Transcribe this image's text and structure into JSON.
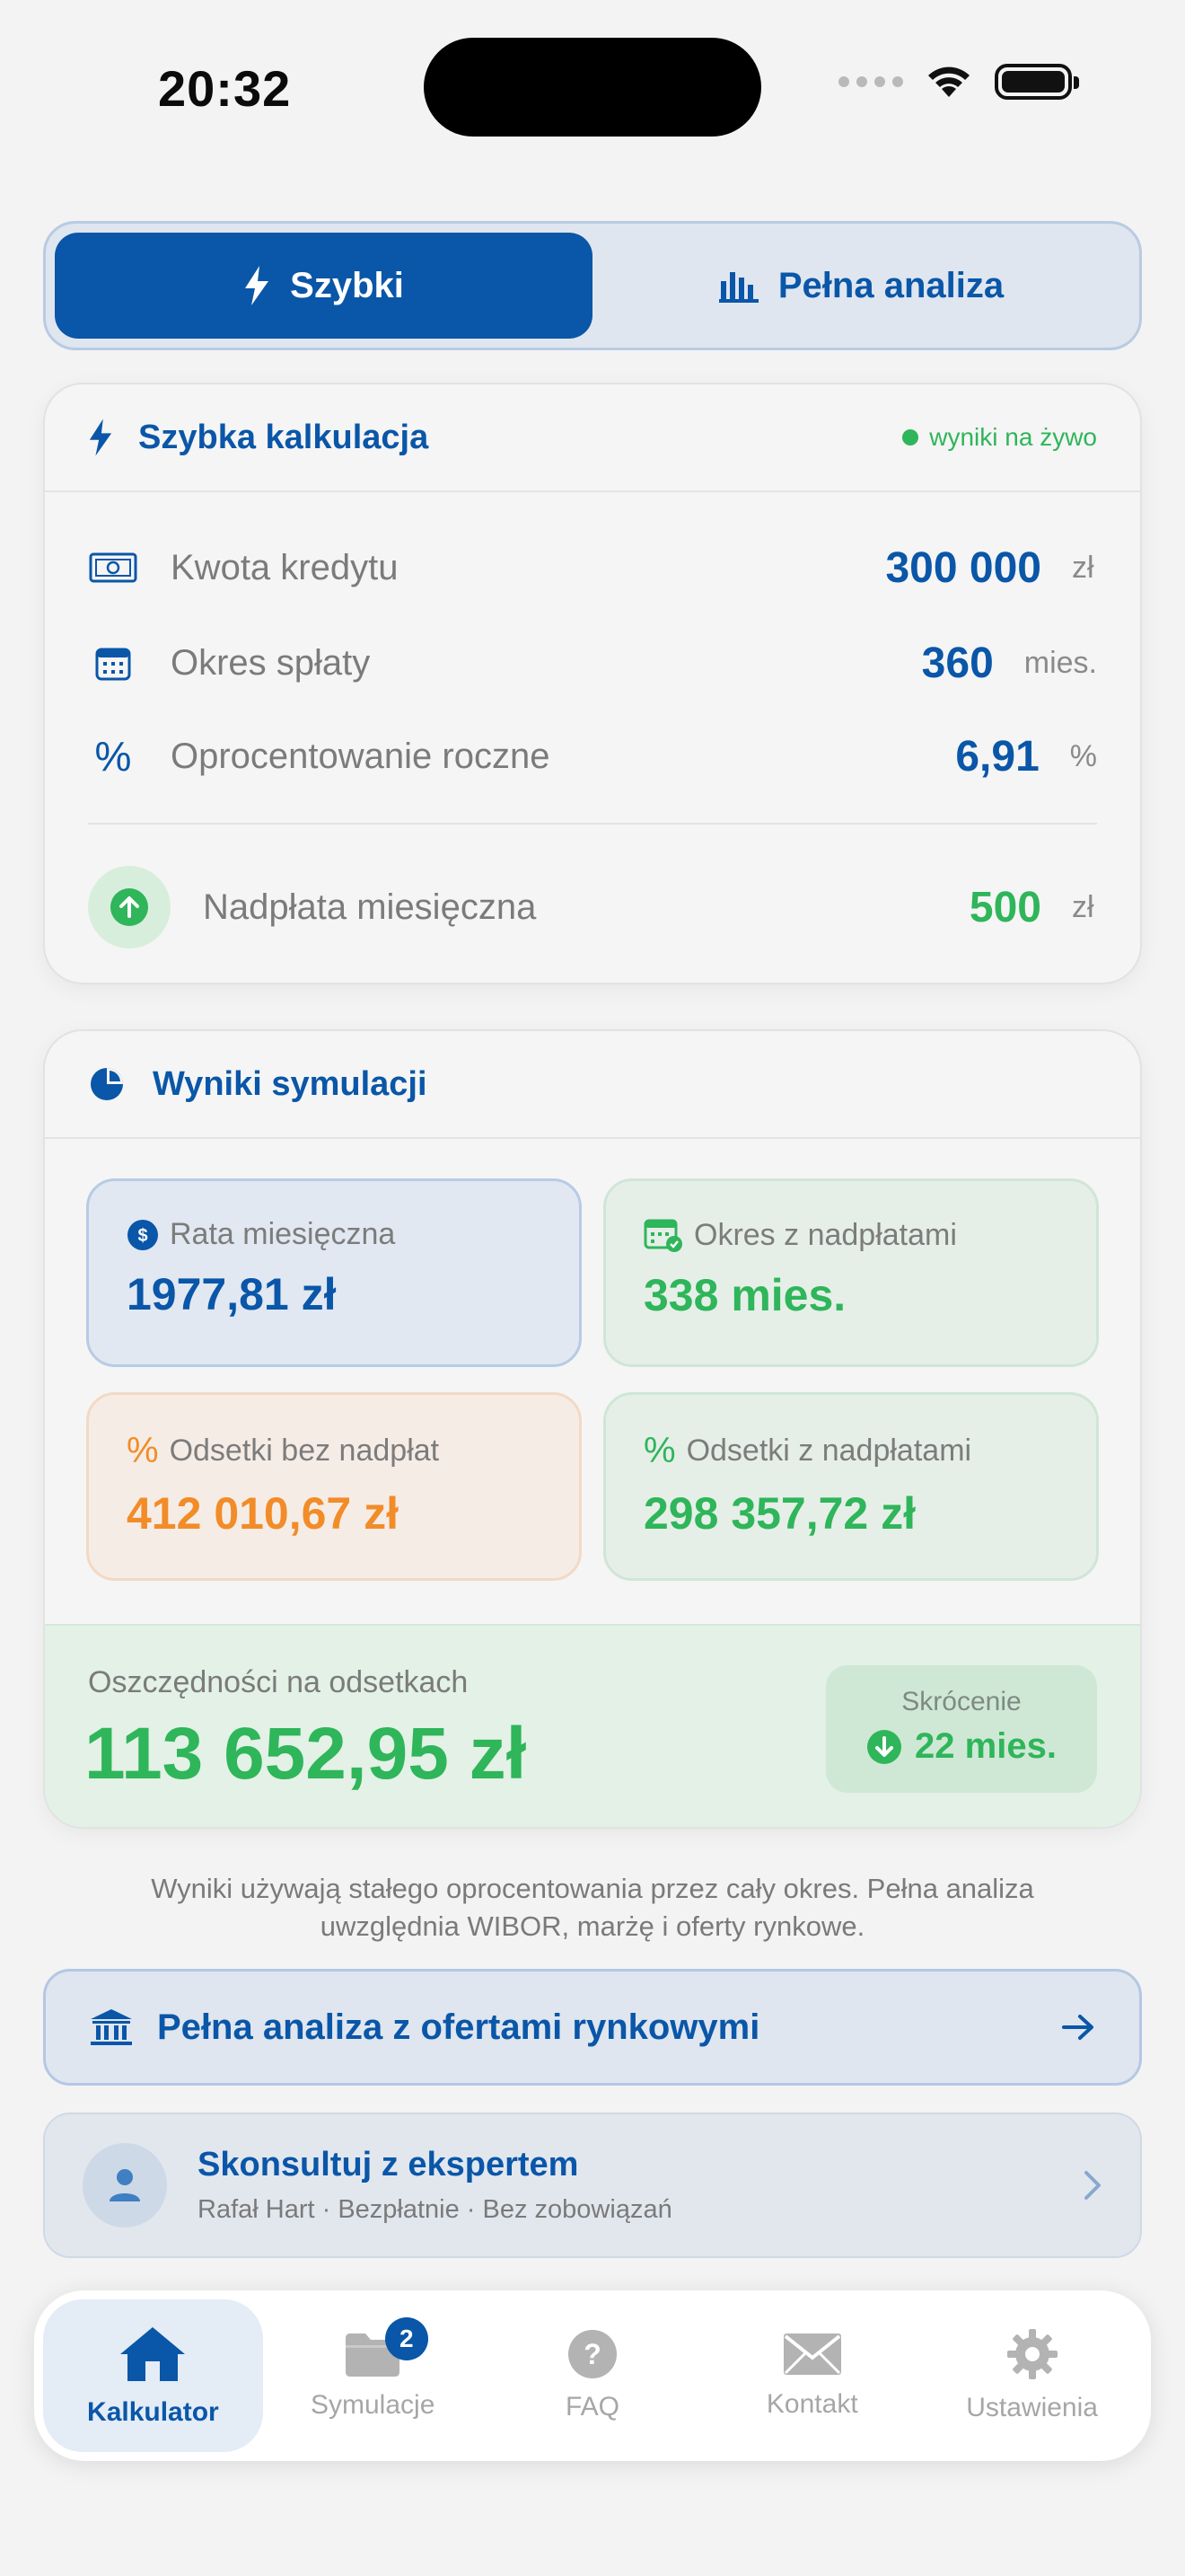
{
  "status": {
    "time": "20:32"
  },
  "segmented": {
    "quick": "Szybki",
    "full": "Pełna analiza"
  },
  "quick_card": {
    "title": "Szybka kalkulacja",
    "live": "wyniki na żywo",
    "loan_label": "Kwota kredytu",
    "loan_value": "300 000",
    "loan_unit": "zł",
    "term_label": "Okres spłaty",
    "term_value": "360",
    "term_unit": "mies.",
    "rate_label": "Oprocentowanie roczne",
    "rate_value": "6,91",
    "rate_unit": "%",
    "overpay_label": "Nadpłata miesięczna",
    "overpay_value": "500",
    "overpay_unit": "zł"
  },
  "results": {
    "title": "Wyniki symulacji",
    "monthly_label": "Rata miesięczna",
    "monthly_value": "1977,81 zł",
    "period_label": "Okres z nadpłatami",
    "period_value": "338 mies.",
    "interest_no_label": "Odsetki bez nadpłat",
    "interest_no_value": "412 010,67 zł",
    "interest_with_label": "Odsetki z nadpłatami",
    "interest_with_value": "298 357,72 zł",
    "savings_label": "Oszczędności na odsetkach",
    "savings_value": "113 652,95 zł",
    "shortening_label": "Skrócenie",
    "shortening_value": "22 mies."
  },
  "note": "Wyniki używają stałego oprocentowania przez cały okres. Pełna analiza uwzględnia WIBOR, marżę i oferty rynkowe.",
  "cta": {
    "label": "Pełna analiza z ofertami rynkowymi"
  },
  "expert": {
    "title": "Skonsultuj z ekspertem",
    "subtitle": "Rafał Hart · Bezpłatnie · Bez zobowiązań"
  },
  "tabs": [
    {
      "label": "Kalkulator"
    },
    {
      "label": "Symulacje",
      "badge": "2"
    },
    {
      "label": "FAQ"
    },
    {
      "label": "Kontakt"
    },
    {
      "label": "Ustawienia"
    }
  ],
  "colors": {
    "primary": "#0a56a8",
    "green": "#2fb55a",
    "orange": "#f28c28"
  }
}
